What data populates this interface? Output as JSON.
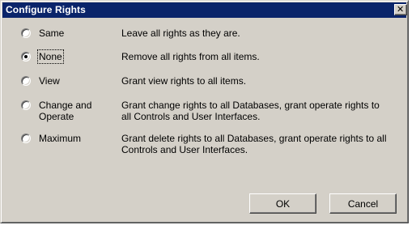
{
  "window": {
    "title": "Configure Rights",
    "close_icon": "close-icon"
  },
  "options": [
    {
      "label": "Same",
      "description": "Leave all rights as they are.",
      "selected": false
    },
    {
      "label": "None",
      "description": "Remove all rights from all items.",
      "selected": true
    },
    {
      "label": "View",
      "description": "Grant view rights to all items.",
      "selected": false
    },
    {
      "label": "Change and Operate",
      "description": "Grant change rights to all Databases, grant operate rights to all Controls and User Interfaces.",
      "selected": false
    },
    {
      "label": "Maximum",
      "description": "Grant delete rights to all Databases, grant operate rights to all Controls and User Interfaces.",
      "selected": false
    }
  ],
  "buttons": {
    "ok": "OK",
    "cancel": "Cancel"
  },
  "colors": {
    "titlebar": "#0a246a",
    "face": "#d4d0c8"
  }
}
